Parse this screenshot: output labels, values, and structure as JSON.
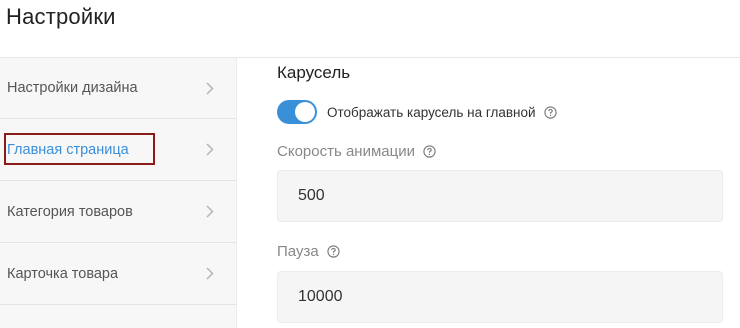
{
  "page": {
    "title": "Настройки"
  },
  "sidebar": {
    "items": [
      {
        "label": "Настройки дизайна",
        "active": false
      },
      {
        "label": "Главная страница",
        "active": true
      },
      {
        "label": "Категория товаров",
        "active": false
      },
      {
        "label": "Карточка товара",
        "active": false
      }
    ]
  },
  "main": {
    "section_title": "Карусель",
    "carousel_toggle": {
      "label": "Отображать карусель на главной",
      "checked": true
    },
    "animation_speed": {
      "label": "Скорость анимации",
      "value": "500"
    },
    "pause": {
      "label": "Пауза",
      "value": "10000"
    }
  },
  "colors": {
    "accent": "#3a8fd9",
    "highlight_outline": "#8b1a1a"
  },
  "icons": {
    "chevron": "chevron-right-icon",
    "help": "help-circle-icon"
  }
}
